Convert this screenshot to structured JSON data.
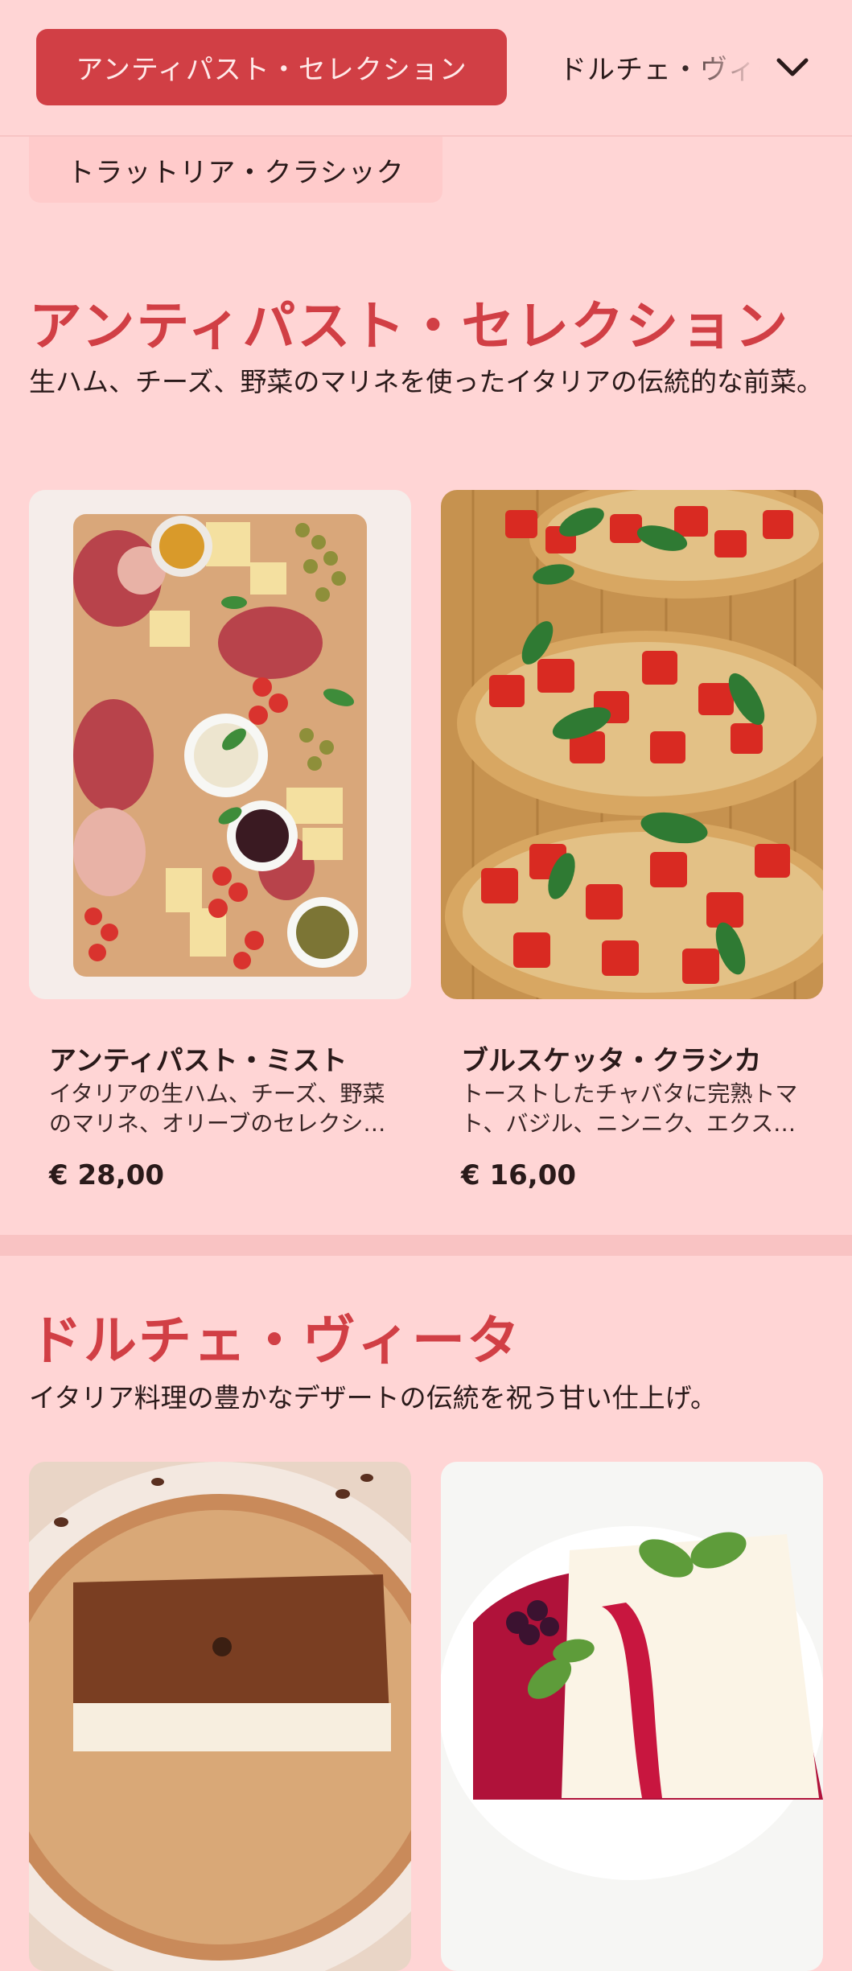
{
  "category_nav": {
    "active_label": "アンティパスト・セレクション",
    "next_label": "ドルチェ・ヴィータ",
    "second_row_label": "トラットリア・クラシック",
    "expand_icon": "chevron-down-icon"
  },
  "sections": [
    {
      "title": "アンティパスト・セレクション",
      "description": "生ハム、チーズ、野菜のマリネを使ったイタリアの伝統的な前菜。",
      "items": [
        {
          "name": "アンティパスト・ミスト",
          "description": "イタリアの生ハム、チーズ、野菜のマリネ、オリーブのセレクション",
          "price": "€ 28,00",
          "image_icon": "antipasto-platter-image"
        },
        {
          "name": "ブルスケッタ・クラシカ",
          "description": "トーストしたチャバタに完熟トマト、バジル、ニンニク、エクストラバージンオリーブオイル",
          "price": "€ 16,00",
          "image_icon": "bruschetta-image"
        }
      ]
    },
    {
      "title": "ドルチェ・ヴィータ",
      "description": "イタリア料理の豊かなデザートの伝統を祝う甘い仕上げ。",
      "items": [
        {
          "image_icon": "tiramisu-image"
        },
        {
          "image_icon": "panna-cotta-image"
        }
      ]
    }
  ],
  "colors": {
    "background": "#FFD5D5",
    "accent": "#D13F45",
    "text": "#2A1A1A"
  }
}
